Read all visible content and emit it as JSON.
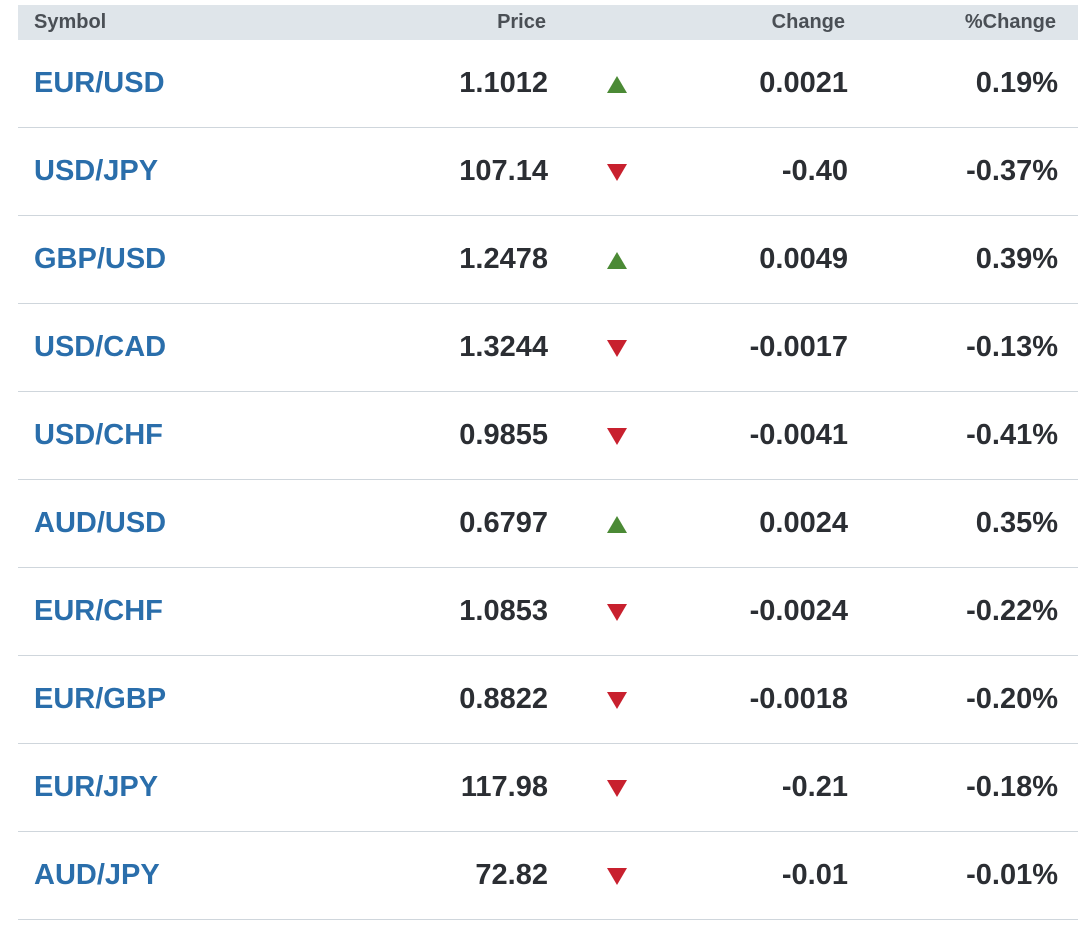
{
  "table": {
    "headers": {
      "symbol": "Symbol",
      "price": "Price",
      "change": "Change",
      "pct_change": "%Change"
    },
    "colors": {
      "header_bg": "#dfe5ea",
      "symbol": "#2a6eab",
      "up": "#4b8a35",
      "down": "#c8202e",
      "divider": "#cfd6dc"
    },
    "rows": [
      {
        "symbol": "EUR/USD",
        "price": "1.1012",
        "direction": "up",
        "direction_icon": "triangle-up-icon",
        "change": "0.0021",
        "pct_change": "0.19%"
      },
      {
        "symbol": "USD/JPY",
        "price": "107.14",
        "direction": "down",
        "direction_icon": "triangle-down-icon",
        "change": "-0.40",
        "pct_change": "-0.37%"
      },
      {
        "symbol": "GBP/USD",
        "price": "1.2478",
        "direction": "up",
        "direction_icon": "triangle-up-icon",
        "change": "0.0049",
        "pct_change": "0.39%"
      },
      {
        "symbol": "USD/CAD",
        "price": "1.3244",
        "direction": "down",
        "direction_icon": "triangle-down-icon",
        "change": "-0.0017",
        "pct_change": "-0.13%"
      },
      {
        "symbol": "USD/CHF",
        "price": "0.9855",
        "direction": "down",
        "direction_icon": "triangle-down-icon",
        "change": "-0.0041",
        "pct_change": "-0.41%"
      },
      {
        "symbol": "AUD/USD",
        "price": "0.6797",
        "direction": "up",
        "direction_icon": "triangle-up-icon",
        "change": "0.0024",
        "pct_change": "0.35%"
      },
      {
        "symbol": "EUR/CHF",
        "price": "1.0853",
        "direction": "down",
        "direction_icon": "triangle-down-icon",
        "change": "-0.0024",
        "pct_change": "-0.22%"
      },
      {
        "symbol": "EUR/GBP",
        "price": "0.8822",
        "direction": "down",
        "direction_icon": "triangle-down-icon",
        "change": "-0.0018",
        "pct_change": "-0.20%"
      },
      {
        "symbol": "EUR/JPY",
        "price": "117.98",
        "direction": "down",
        "direction_icon": "triangle-down-icon",
        "change": "-0.21",
        "pct_change": "-0.18%"
      },
      {
        "symbol": "AUD/JPY",
        "price": "72.82",
        "direction": "down",
        "direction_icon": "triangle-down-icon",
        "change": "-0.01",
        "pct_change": "-0.01%"
      }
    ]
  }
}
